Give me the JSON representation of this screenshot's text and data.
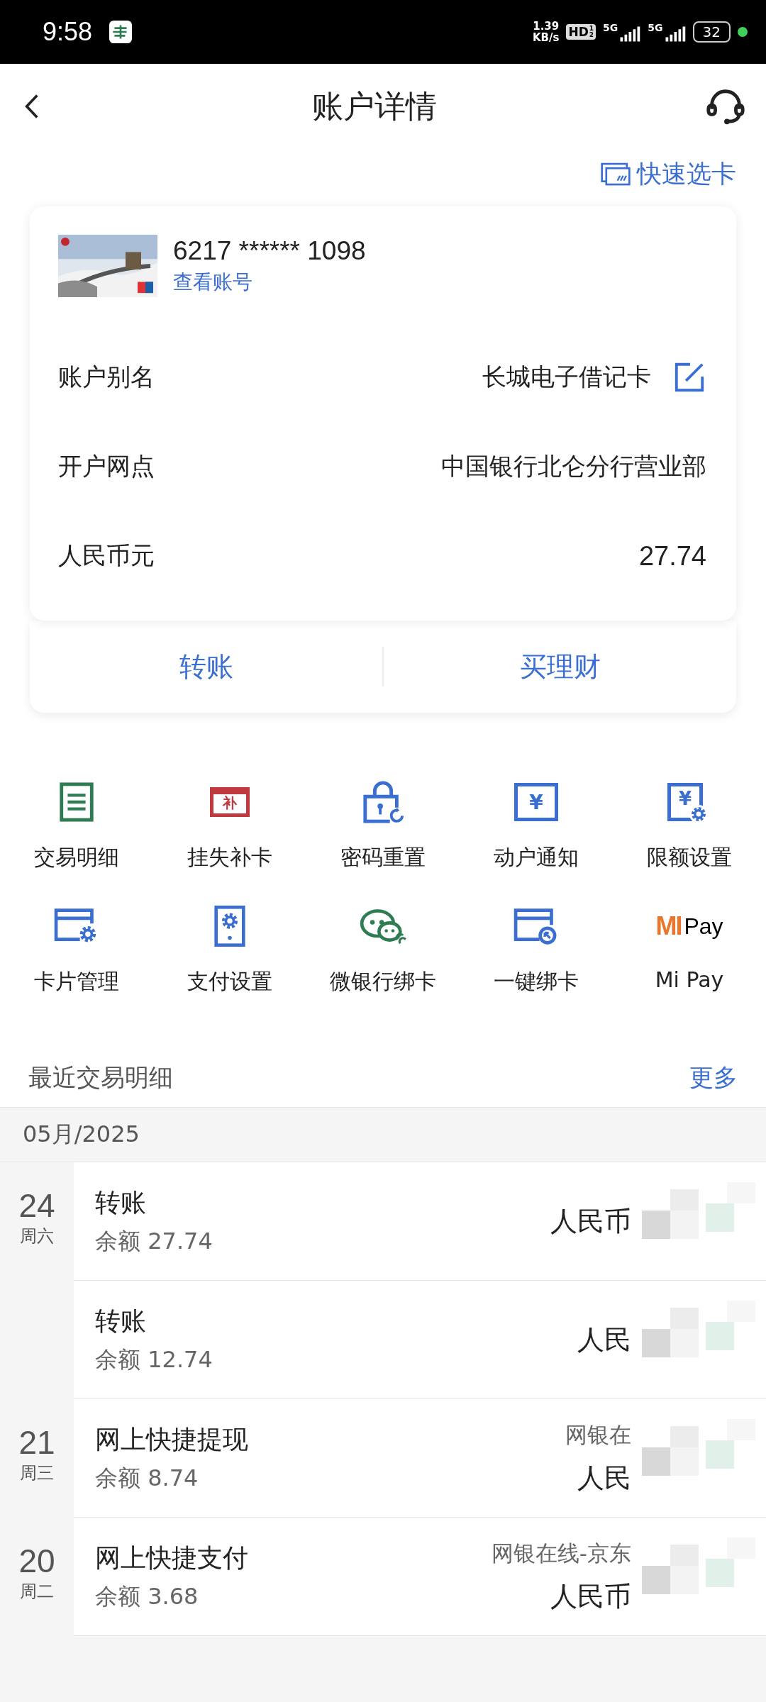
{
  "status_bar": {
    "time": "9:58",
    "net_speed": [
      "1.39",
      "KB/s"
    ],
    "hd": "HD",
    "hd_sub": "1\n2",
    "networks": [
      "5G",
      "5G"
    ],
    "battery": "32"
  },
  "header": {
    "title": "账户详情"
  },
  "quick_select": "快速选卡",
  "card": {
    "number": "6217 ****** 1098",
    "view_link": "查看账号",
    "rows": [
      {
        "label": "账户别名",
        "value": "长城电子借记卡",
        "editable": true
      },
      {
        "label": "开户网点",
        "value": "中国银行北仑分行营业部",
        "editable": false
      },
      {
        "label": "人民币元",
        "value": "27.74",
        "editable": false
      }
    ],
    "actions": [
      "转账",
      "买理财"
    ]
  },
  "services": [
    {
      "kind": "list",
      "label": "交易明细",
      "color": "#2e7d52"
    },
    {
      "kind": "replace",
      "label": "挂失补卡",
      "color": "#c0393f",
      "icon_text": "补"
    },
    {
      "kind": "lock",
      "label": "密码重置",
      "color": "#3a6fd1"
    },
    {
      "kind": "notice",
      "label": "动户通知",
      "color": "#3a6fd1",
      "icon_text": "¥"
    },
    {
      "kind": "limit",
      "label": "限额设置",
      "color": "#3a6fd1",
      "icon_text": "¥"
    },
    {
      "kind": "card_gear",
      "label": "卡片管理",
      "color": "#3a6fd1"
    },
    {
      "kind": "phone_gear",
      "label": "支付设置",
      "color": "#3a6fd1"
    },
    {
      "kind": "wechat",
      "label": "微银行绑卡",
      "color": "#2e7d52"
    },
    {
      "kind": "card_bind",
      "label": "一键绑卡",
      "color": "#3a6fd1"
    },
    {
      "kind": "mipay",
      "label": "Mi Pay",
      "color": "#e8762c",
      "icon_text": "MI",
      "icon_suffix": "Pay"
    }
  ],
  "recent": {
    "title": "最近交易明细",
    "more": "更多",
    "month": "05月/2025",
    "days": [
      {
        "day": "24",
        "weekday": "周六",
        "items": [
          {
            "title": "转账",
            "balance": "余额 27.74",
            "amount": "人民币"
          },
          {
            "title": "转账",
            "balance": "余额 12.74",
            "amount": "人民"
          }
        ]
      },
      {
        "day": "21",
        "weekday": "周三",
        "items": [
          {
            "title": "网上快捷提现",
            "balance": "余额 8.74",
            "merchant": "网银在",
            "amount": "人民"
          }
        ]
      },
      {
        "day": "20",
        "weekday": "周二",
        "items": [
          {
            "title": "网上快捷支付",
            "balance": "余额 3.68",
            "merchant": "网银在线-京东",
            "amount": "人民币"
          }
        ]
      }
    ]
  }
}
